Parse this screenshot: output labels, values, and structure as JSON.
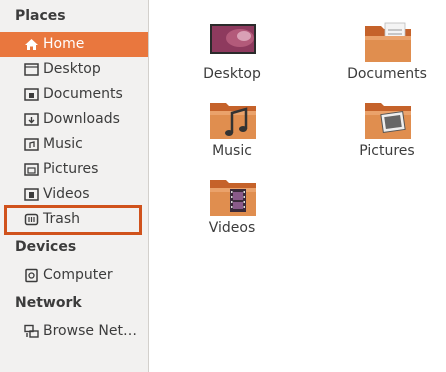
{
  "sidebar": {
    "places_title": "Places",
    "places": [
      {
        "label": "Home",
        "icon": "home-icon",
        "active": true
      },
      {
        "label": "Desktop",
        "icon": "folder-icon"
      },
      {
        "label": "Documents",
        "icon": "documents-folder-icon"
      },
      {
        "label": "Downloads",
        "icon": "downloads-folder-icon"
      },
      {
        "label": "Music",
        "icon": "music-folder-icon"
      },
      {
        "label": "Pictures",
        "icon": "pictures-folder-icon"
      },
      {
        "label": "Videos",
        "icon": "videos-folder-icon"
      },
      {
        "label": "Trash",
        "icon": "trash-icon",
        "highlighted": true
      }
    ],
    "devices_title": "Devices",
    "devices": [
      {
        "label": "Computer",
        "icon": "computer-icon"
      }
    ],
    "network_title": "Network",
    "network": [
      {
        "label": "Browse Net…",
        "icon": "network-icon"
      }
    ]
  },
  "main": {
    "items": [
      {
        "label": "Desktop",
        "icon": "desktop-icon"
      },
      {
        "label": "Documents",
        "icon": "documents-folder-icon"
      },
      {
        "label": "Music",
        "icon": "music-folder-icon"
      },
      {
        "label": "Pictures",
        "icon": "pictures-folder-icon"
      },
      {
        "label": "Videos",
        "icon": "videos-folder-icon"
      }
    ]
  },
  "colors": {
    "accent": "#e9773e",
    "highlight_border": "#d0521c",
    "folder": "#dd8a4c",
    "sidebar_bg": "#f2f1f0"
  }
}
